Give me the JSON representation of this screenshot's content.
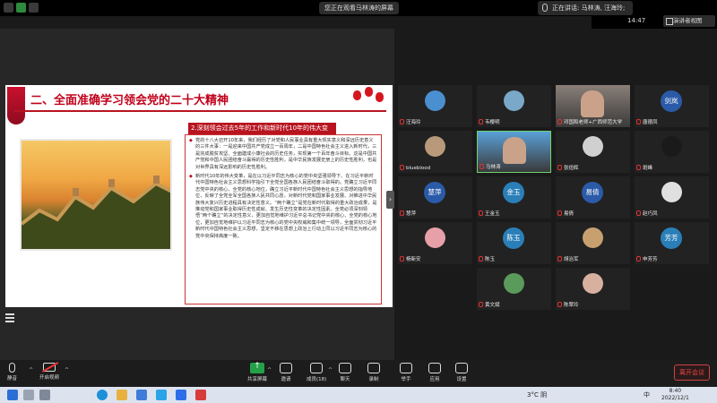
{
  "topbar": {
    "viewing_text": "您正在观看马林涛的屏幕",
    "speaking_text": "正在讲话: 马林涛, 汪海玲;",
    "clock": "14:47",
    "view_mode": "演讲者视图"
  },
  "slide": {
    "title": "二、全面准确学习领会党的二十大精神",
    "section_header": "2.深刻领会过去5年的工作和新时代10年的伟大变革。",
    "para1": "党的十八大召开10年来，我们经历了对党和人民事业具有重大现实意义和深远历史意义的三件大事：一是迎来中国共产党成立一百周年，二是中国特色社会主义进入新时代，三是完成脱贫攻坚、全面建成小康社会的历史任务，实现第一个百年奋斗目标。这是中国共产党和中国人民团结奋斗赢得的历史性胜利，是中华民族发展史册上的历史性胜利，也是对世界具有深远影响的历史性胜利。",
    "para2": "新时代10年的伟大变革，是在以习近平同志为核心的党中央坚强领导下、在习近平新时代中国特色社会主义思想科学指引下全党全国各族人民团结奋斗取得的。党确立习近平同志党中央的核心、全党的核心地位，确立习近平新时代中国特色社会主义思想的指导地位，反映了全党全军全国各族人民共同心愿，对新时代党和国家事业发展、对推进中华民族伟大复兴历史进程具有决定性意义。“两个确立”是党在新时代取得的重大政治成果，是推动党和国家事业取得历史性成就、发生历史性变革的决定性因素。全党必须深刻领悟“两个确立”的决定性意义，更加自觉地维护习近平总书记党中央的核心、全党的核心地位，更加自觉地维护以习近平同志为核心的党中央权威和集中统一领导，全面贯彻习近平新时代中国特色社会主义思想，坚定不移在思想上政治上行动上同以习近平同志为核心的党中央保持高度一致。"
  },
  "gallery": [
    {
      "label": "汪海玲",
      "avatar_text": "",
      "avatar_type": "photo",
      "color": "#4a8fd0"
    },
    {
      "label": "韦樱明",
      "avatar_text": "",
      "avatar_type": "photo",
      "color": "#7aa8c8"
    },
    {
      "label": "邓国和老师+广西师范大学",
      "avatar_text": "",
      "avatar_type": "video",
      "color": "#8a7f78"
    },
    {
      "label": "唐德凤",
      "avatar_text": "剑岚",
      "avatar_type": "text",
      "color": "#2b5ba8"
    },
    {
      "label": "blueblood",
      "avatar_text": "",
      "avatar_type": "photo",
      "color": "#b89a7a"
    },
    {
      "label": "马林涛",
      "avatar_text": "",
      "avatar_type": "video",
      "color": "#5aa0d8"
    },
    {
      "label": "张烜辉",
      "avatar_text": "",
      "avatar_type": "photo",
      "color": "#d0d0d0"
    },
    {
      "label": "斑峰",
      "avatar_text": "",
      "avatar_type": "photo",
      "color": "#1a1a1a"
    },
    {
      "label": "慧萍",
      "avatar_text": "慧萍",
      "avatar_type": "text",
      "color": "#2b5ba8"
    },
    {
      "label": "王金玉",
      "avatar_text": "金玉",
      "avatar_type": "text",
      "color": "#2b7fb8"
    },
    {
      "label": "易倩",
      "avatar_text": "易倩",
      "avatar_type": "text",
      "color": "#2b5ba8"
    },
    {
      "label": "赵巧凤",
      "avatar_text": "",
      "avatar_type": "photo",
      "color": "#e0e0e0"
    },
    {
      "label": "杨新安",
      "avatar_text": "",
      "avatar_type": "photo",
      "color": "#e8a0a8"
    },
    {
      "label": "陈玉",
      "avatar_text": "陈玉",
      "avatar_type": "text",
      "color": "#2b7fb8"
    },
    {
      "label": "胡治军",
      "avatar_text": "",
      "avatar_type": "photo",
      "color": "#c8a070"
    },
    {
      "label": "申芳芳",
      "avatar_text": "芳芳",
      "avatar_type": "text",
      "color": "#2b7fb8"
    },
    {
      "label": "黄文斌",
      "avatar_text": "",
      "avatar_type": "photo",
      "color": "#5a9a5a"
    },
    {
      "label": "陈翠玲",
      "avatar_text": "",
      "avatar_type": "photo",
      "color": "#d8b0a0"
    }
  ],
  "toolbar": {
    "mute": "静音",
    "video": "开启视频",
    "share": "共享屏幕",
    "invite": "邀请",
    "members": "成员(18)",
    "chat": "聊天",
    "record": "录制",
    "raise_hand": "举手",
    "apps": "应用",
    "settings": "设置",
    "leave": "离开会议"
  },
  "taskbar": {
    "weather": "3°C 阴",
    "lang": "中",
    "time": "8:40",
    "date": "2022/12/1"
  }
}
